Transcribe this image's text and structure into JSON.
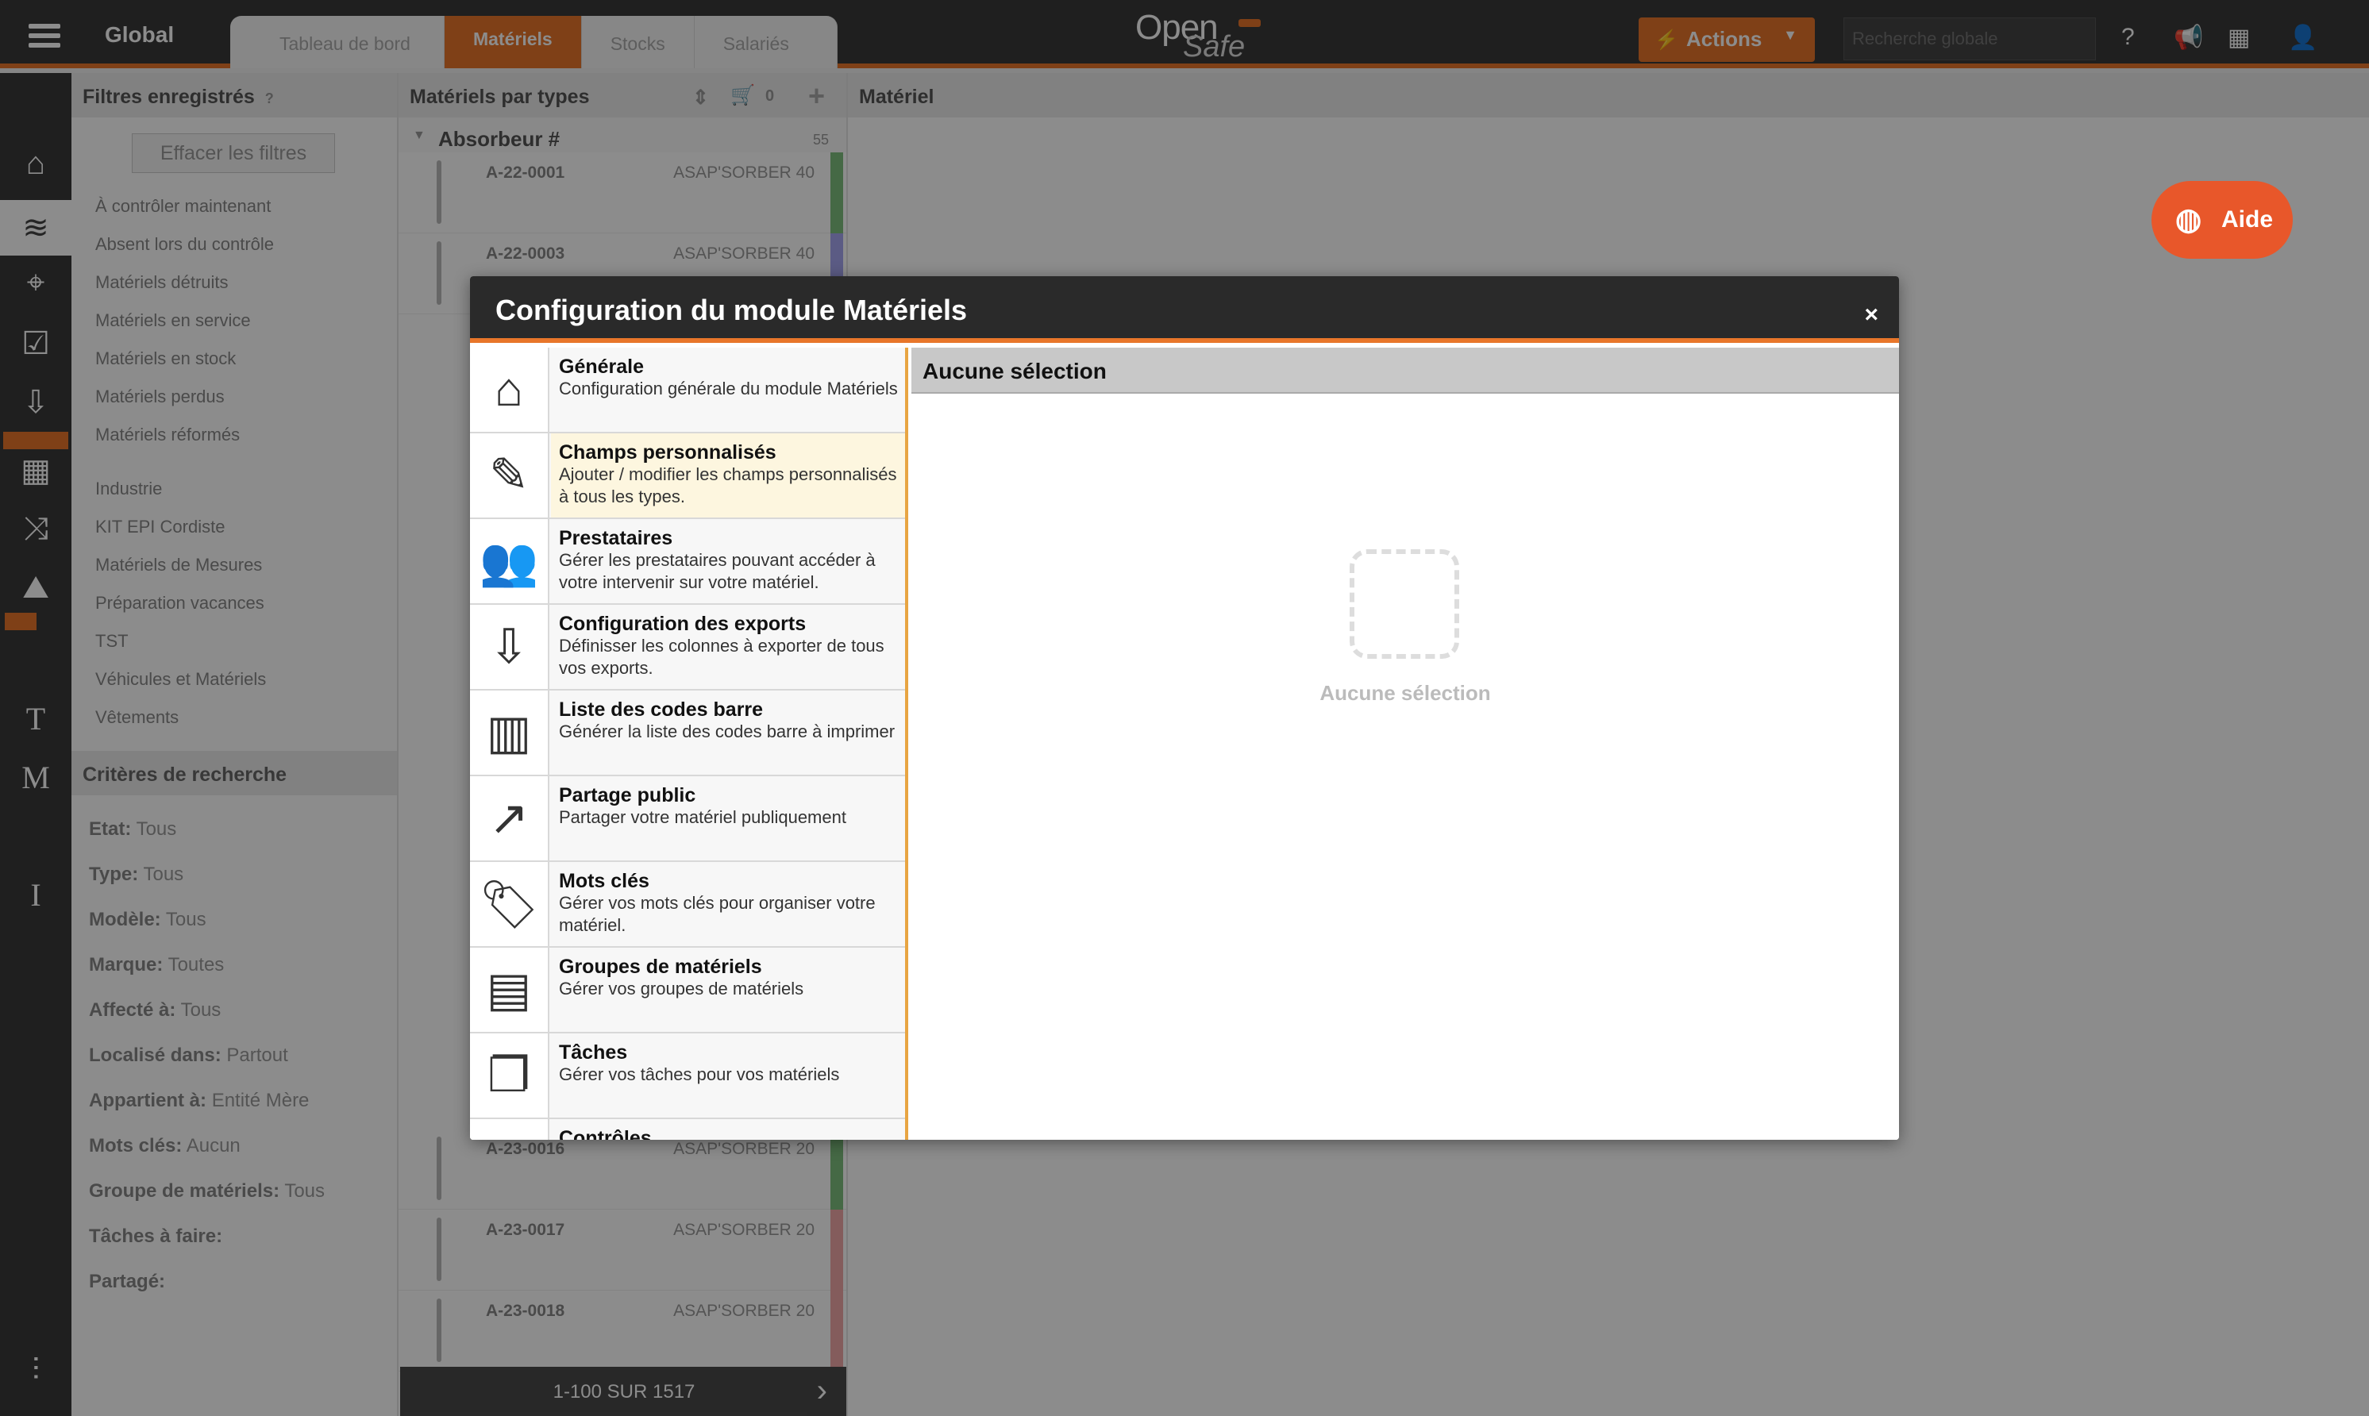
{
  "topbar": {
    "title": "Global",
    "tabs": [
      "Tableau de bord",
      "Matériels",
      "Stocks",
      "Salariés"
    ],
    "active_tab": "Matériels",
    "logo_open": "Open",
    "logo_safe": "Safe",
    "actions_label": "Actions",
    "search_placeholder": "Recherche globale",
    "icons": [
      "help-icon",
      "megaphone-icon",
      "building-icon",
      "user-icon"
    ]
  },
  "leftnav": {
    "icons": [
      "home-icon",
      "layers-icon",
      "map-pin-icon",
      "checklist-icon",
      "inbox-icon",
      "calendar-icon",
      "shuffle-icon",
      "chart-icon",
      "text-t-icon",
      "text-m-icon",
      "text-i-icon",
      "sliders-icon"
    ]
  },
  "filters": {
    "header": "Filtres enregistrés",
    "clear_button": "Effacer les filtres",
    "items_group1": [
      "À contrôler maintenant",
      "Absent lors du contrôle",
      "Matériels détruits",
      "Matériels en service",
      "Matériels en stock",
      "Matériels perdus",
      "Matériels réformés"
    ],
    "items_group2": [
      "Industrie",
      "KIT EPI Cordiste",
      "Matériels de Mesures",
      "Préparation vacances",
      "TST",
      "Véhicules et Matériels",
      "Vêtements"
    ],
    "criteria_header": "Critères de recherche",
    "criteria": [
      {
        "label": "Etat:",
        "value": "Tous"
      },
      {
        "label": "Type:",
        "value": "Tous"
      },
      {
        "label": "Modèle:",
        "value": "Tous"
      },
      {
        "label": "Marque:",
        "value": "Toutes"
      },
      {
        "label": "Affecté à:",
        "value": "Tous"
      },
      {
        "label": "Localisé dans:",
        "value": "Partout"
      },
      {
        "label": "Appartient à:",
        "value": "Entité Mère"
      },
      {
        "label": "Mots clés:",
        "value": "Aucun"
      },
      {
        "label": "Groupe de matériels:",
        "value": "Tous"
      },
      {
        "label": "Tâches à faire:",
        "value": ""
      },
      {
        "label": "Partagé:",
        "value": ""
      }
    ]
  },
  "matlist": {
    "header": "Matériels par types",
    "cart_count": "0",
    "group_name": "Absorbeur #",
    "group_count": "55",
    "rows": [
      {
        "code": "A-22-0001",
        "model": "ASAP'SORBER 40",
        "strip": "#7fc07f"
      },
      {
        "code": "A-22-0003",
        "model": "ASAP'SORBER 40",
        "strip": "#a7a7f0"
      },
      {
        "code": "A-23-0016",
        "model": "ASAP'SORBER 20",
        "strip": "#7fc07f"
      },
      {
        "code": "A-23-0017",
        "model": "ASAP'SORBER 20",
        "strip": "#f0a8a8"
      },
      {
        "code": "A-23-0018",
        "model": "ASAP'SORBER 20",
        "strip": "#f0a8a8"
      }
    ],
    "pager": "1-100 SUR 1517"
  },
  "matpanel": {
    "header": "Matériel"
  },
  "aide_label": "Aide",
  "modal": {
    "title": "Configuration du module Matériels",
    "close": "×",
    "menu": [
      {
        "title": "Générale",
        "desc": "Configuration générale du module Matériels",
        "icon": "house-icon",
        "glyph": "⌂"
      },
      {
        "title": "Champs personnalisés",
        "desc": "Ajouter / modifier les champs personnalisés à tous les types.",
        "icon": "edit-icon",
        "glyph": "✎"
      },
      {
        "title": "Prestataires",
        "desc": "Gérer les prestataires pouvant accéder à votre intervenir sur votre matériel.",
        "icon": "users-icon",
        "glyph": "👥"
      },
      {
        "title": "Configuration des exports",
        "desc": "Définisser les colonnes à exporter de tous vos exports.",
        "icon": "export-file-icon",
        "glyph": "⇩"
      },
      {
        "title": "Liste des codes barre",
        "desc": "Générer la liste des codes barre à imprimer",
        "icon": "barcode-icon",
        "glyph": "▥"
      },
      {
        "title": "Partage public",
        "desc": "Partager votre matériel publiquement",
        "icon": "share-icon",
        "glyph": "↗"
      },
      {
        "title": "Mots clés",
        "desc": "Gérer vos mots clés pour organiser votre matériel.",
        "icon": "tag-icon",
        "glyph": "🏷"
      },
      {
        "title": "Groupes de matériels",
        "desc": "Gérer vos groupes de matériels",
        "icon": "binders-icon",
        "glyph": "▤"
      },
      {
        "title": "Tâches",
        "desc": "Gérer vos tâches pour vos matériels",
        "icon": "cards-icon",
        "glyph": "❐"
      },
      {
        "title": "Contrôles",
        "desc": "",
        "icon": "check-icon",
        "glyph": "✓"
      }
    ],
    "content_header": "Aucune sélection",
    "empty_label": "Aucune sélection"
  }
}
